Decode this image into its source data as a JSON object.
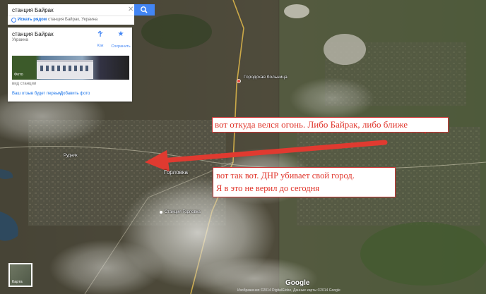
{
  "search": {
    "value": "станция Байрак",
    "clear_icon": "close-icon",
    "button_icon": "search-icon"
  },
  "nearby": {
    "link": "Искать рядом",
    "station": "станция Байрак, Украина"
  },
  "place": {
    "title": "станция Байрак",
    "subtitle": "Украина",
    "directions_label": "Как добраться",
    "save_label": "Сохранить",
    "photo_label": "Фото",
    "caption": "вид станции",
    "review_link": "Ваш отзыв будет первым",
    "add_photo_link": "Добавить фото"
  },
  "map_labels": {
    "hospital": "Городская больница",
    "gorlovka": "Горловка",
    "station_gorlovka": "Станция Горловка",
    "small": "Рудник"
  },
  "annotations": {
    "fire_note": "вот откуда велся огонь. Либо Байрак, либо ближе",
    "dnr_line1": "вот так вот. ДНР убивает свой город.",
    "dnr_line2": "Я в это не верил до сегодня"
  },
  "map_type_label": "Карта",
  "google_logo": "Google",
  "attribution": "Изображения ©2014 DigitalGlobe, Данные карты ©2014 Google",
  "colors": {
    "accent": "#4285f4",
    "arrow": "#e03a30",
    "annotation_text": "#e0362c"
  }
}
